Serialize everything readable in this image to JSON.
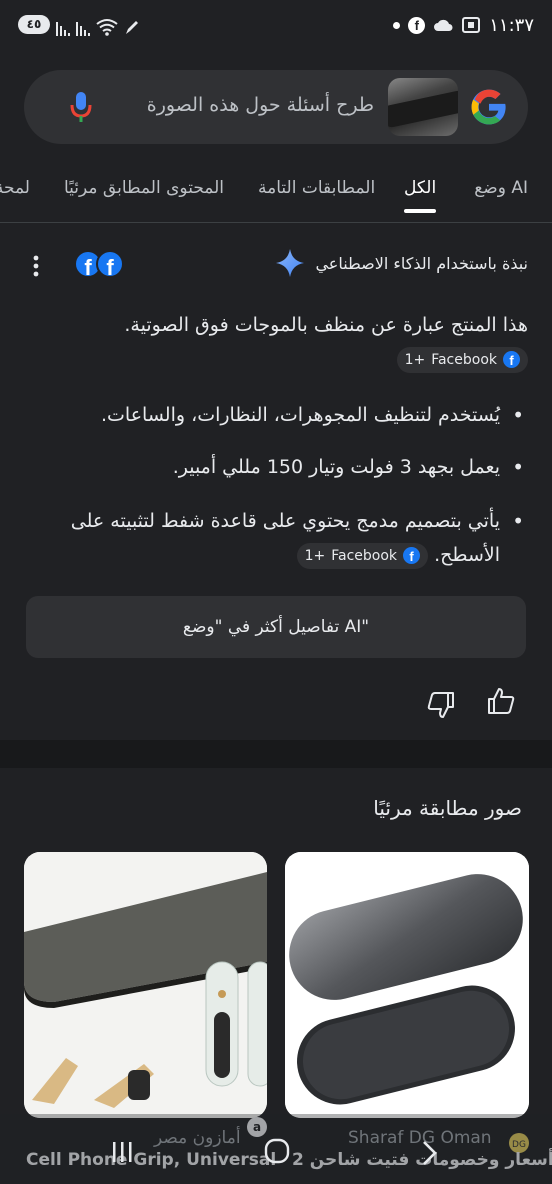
{
  "status_bar": {
    "battery": "٤٥",
    "time": "١١:٣٧"
  },
  "search": {
    "placeholder": "طرح أسئلة حول هذه الصورة"
  },
  "tabs": [
    {
      "label": "وضع AI"
    },
    {
      "label": "الكل",
      "active": true
    },
    {
      "label": "المطابقات التامة"
    },
    {
      "label": "المحتوى المطابق مرئيًا"
    },
    {
      "label": "لمحة"
    }
  ],
  "ai_overview": {
    "title": "نبذة باستخدام الذكاء الاصطناعي",
    "intro": "هذا المنتج عبارة عن منظف بالموجات فوق الصوتية.",
    "bullets": [
      "يُستخدم لتنظيف المجوهرات، النظارات، والساعات.",
      "يعمل بجهد 3 فولت وتيار 150 مللي أمبير.",
      "يأتي بتصميم مدمج يحتوي على قاعدة شفط لتثبيته على الأسطح."
    ],
    "chip_label": "Facebook",
    "chip_count": "1+",
    "more_button": "تفاصيل أكثر في \"وضع AI\""
  },
  "visual_matches": {
    "title": "صور مطابقة مرئيًا",
    "cards": [
      {
        "source": "Sharaf DG Oman",
        "title": "أسعار وخصومات فتيت شاحن 2"
      },
      {
        "source": "أمازون مصر",
        "title": "Cell Phone Grip, Universal"
      }
    ]
  },
  "colors": {
    "background": "#202124",
    "surface": "#303134",
    "facebook": "#1877f2"
  }
}
